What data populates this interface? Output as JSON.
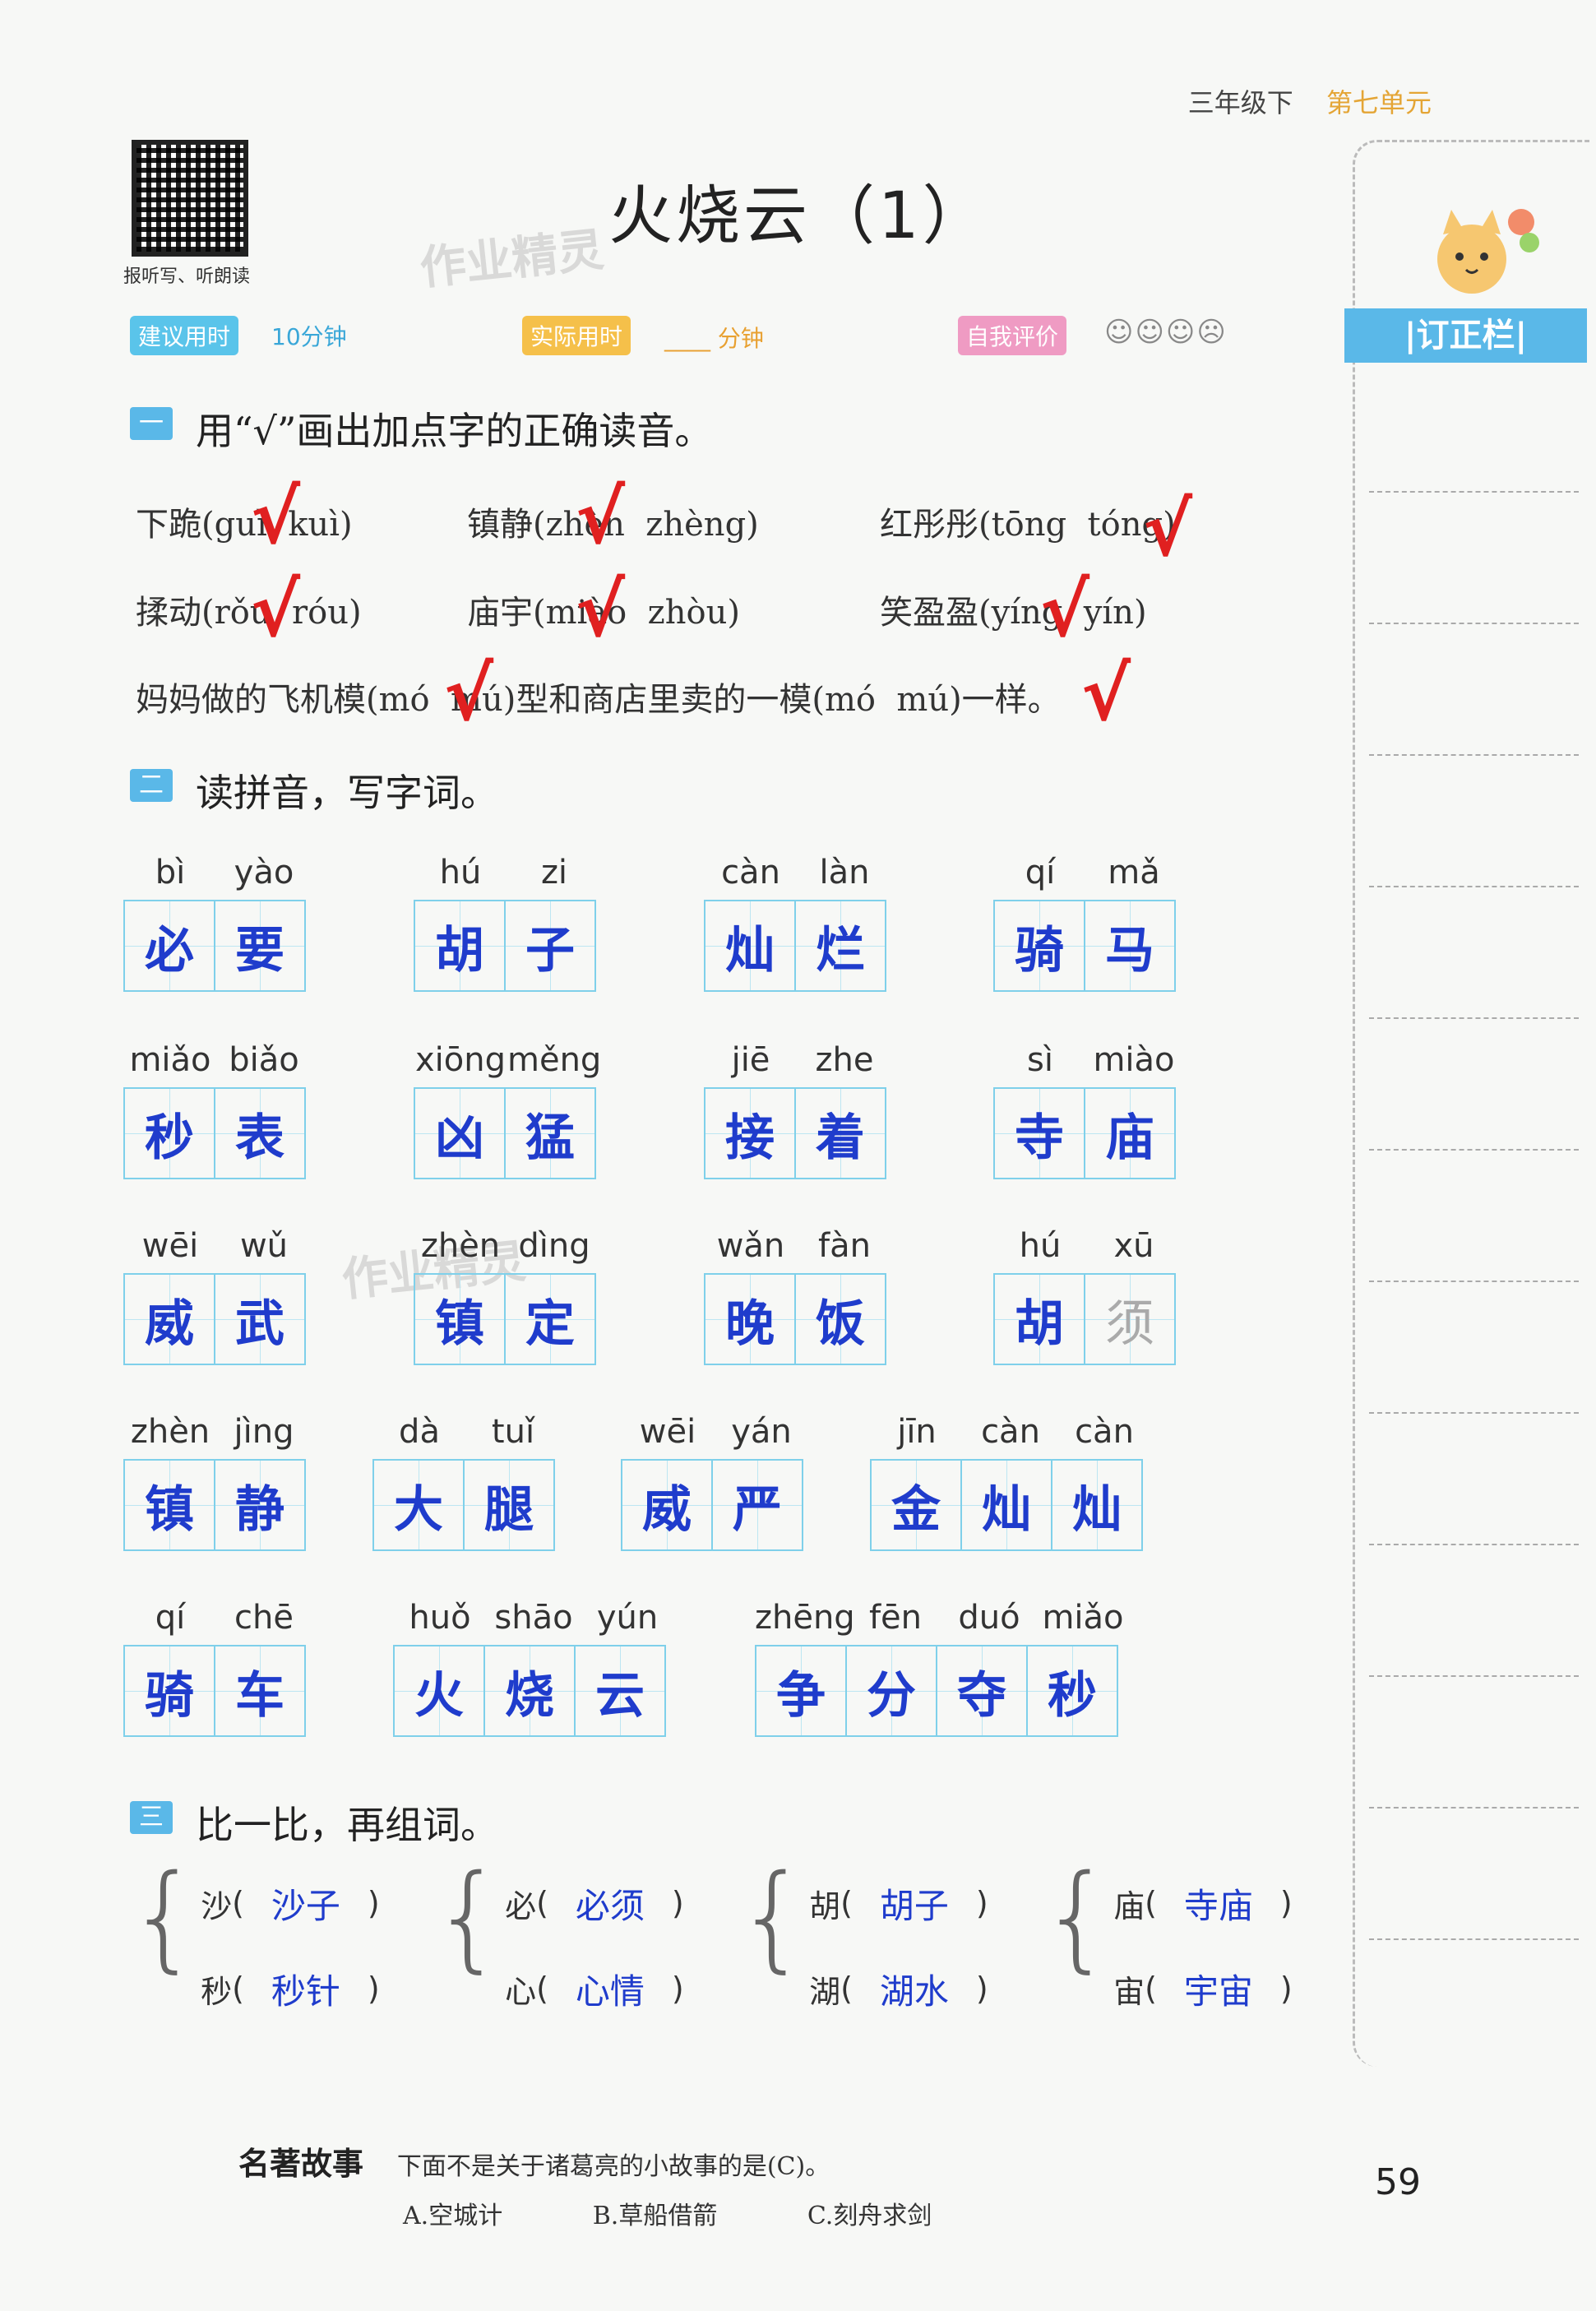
{
  "header": {
    "grade": "三年级下",
    "unit": "第七单元"
  },
  "qr_label": "报听写、听朗读",
  "title": "火烧云（1）",
  "watermark": "作业精灵",
  "meta": {
    "suggest_tag": "建议用时",
    "suggest_val": "10分钟",
    "actual_tag": "实际用时",
    "actual_val": "____ 分钟",
    "self_tag": "自我评价",
    "faces": "☺☺☺☹"
  },
  "sidebar": {
    "label": "|订正栏|"
  },
  "section1": {
    "num": "一",
    "title": "用“√”画出加点字的正确读音。",
    "lines": [
      [
        "下跪(guì  kuì)",
        "镇静(zhèn  zhèng)",
        "红彤彤(tōng  tóng)"
      ],
      [
        "揉动(rǒu  róu)",
        "庙宇(miào  zhòu)",
        "笑盈盈(yíng  yín)"
      ],
      [
        "妈妈做的飞机模(mó  mú)型和商店里卖的一模(mó  mú)一样。"
      ]
    ],
    "check": "√"
  },
  "section2": {
    "num": "二",
    "title": "读拼音，写字词。",
    "rows": [
      [
        {
          "py": [
            "bì",
            "yào"
          ],
          "chars": [
            "必",
            "要"
          ]
        },
        {
          "py": [
            "hú",
            "zi"
          ],
          "chars": [
            "胡",
            "子"
          ]
        },
        {
          "py": [
            "càn",
            "làn"
          ],
          "chars": [
            "灿",
            "烂"
          ]
        },
        {
          "py": [
            "qí",
            "mǎ"
          ],
          "chars": [
            "骑",
            "马"
          ]
        }
      ],
      [
        {
          "py": [
            "miǎo",
            "biǎo"
          ],
          "chars": [
            "秒",
            "表"
          ]
        },
        {
          "py": [
            "xiōng",
            "měng"
          ],
          "chars": [
            "凶",
            "猛"
          ]
        },
        {
          "py": [
            "jiē",
            "zhe"
          ],
          "chars": [
            "接",
            "着"
          ]
        },
        {
          "py": [
            "sì",
            "miào"
          ],
          "chars": [
            "寺",
            "庙"
          ]
        }
      ],
      [
        {
          "py": [
            "wēi",
            "wǔ"
          ],
          "chars": [
            "威",
            "武"
          ]
        },
        {
          "py": [
            "zhèn",
            "dìng"
          ],
          "chars": [
            "镇",
            "定"
          ]
        },
        {
          "py": [
            "wǎn",
            "fàn"
          ],
          "chars": [
            "晚",
            "饭"
          ]
        },
        {
          "py": [
            "hú",
            "xū"
          ],
          "chars": [
            "胡",
            "须"
          ]
        }
      ],
      [
        {
          "py": [
            "zhèn",
            "jìng"
          ],
          "chars": [
            "镇",
            "静"
          ]
        },
        {
          "py": [
            "dà",
            "tuǐ"
          ],
          "chars": [
            "大",
            "腿"
          ]
        },
        {
          "py": [
            "wēi",
            "yán"
          ],
          "chars": [
            "威",
            "严"
          ]
        },
        {
          "py": [
            "jīn",
            "càn",
            "càn"
          ],
          "chars": [
            "金",
            "灿",
            "灿"
          ]
        }
      ],
      [
        {
          "py": [
            "qí",
            "chē"
          ],
          "chars": [
            "骑",
            "车"
          ]
        },
        {
          "py": [
            "huǒ",
            "shāo",
            "yún"
          ],
          "chars": [
            "火",
            "烧",
            "云"
          ]
        },
        {
          "py": [
            "zhēng",
            "fēn",
            "duó",
            "miǎo"
          ],
          "chars": [
            "争",
            "分",
            "夺",
            "秒"
          ]
        }
      ]
    ]
  },
  "section3": {
    "num": "三",
    "title": "比一比，再组词。",
    "groups": [
      [
        {
          "c": "沙",
          "a": "沙子"
        },
        {
          "c": "秒",
          "a": "秒针"
        }
      ],
      [
        {
          "c": "必",
          "a": "必须"
        },
        {
          "c": "心",
          "a": "心情"
        }
      ],
      [
        {
          "c": "胡",
          "a": "胡子"
        },
        {
          "c": "湖",
          "a": "湖水"
        }
      ],
      [
        {
          "c": "庙",
          "a": "寺庙"
        },
        {
          "c": "宙",
          "a": "宇宙"
        }
      ]
    ]
  },
  "story": {
    "label": "名著故事",
    "question": "下面不是关于诸葛亮的小故事的是(C)。",
    "options": [
      "A.空城计",
      "B.草船借箭",
      "C.刻舟求剑"
    ]
  },
  "page_number": "59"
}
